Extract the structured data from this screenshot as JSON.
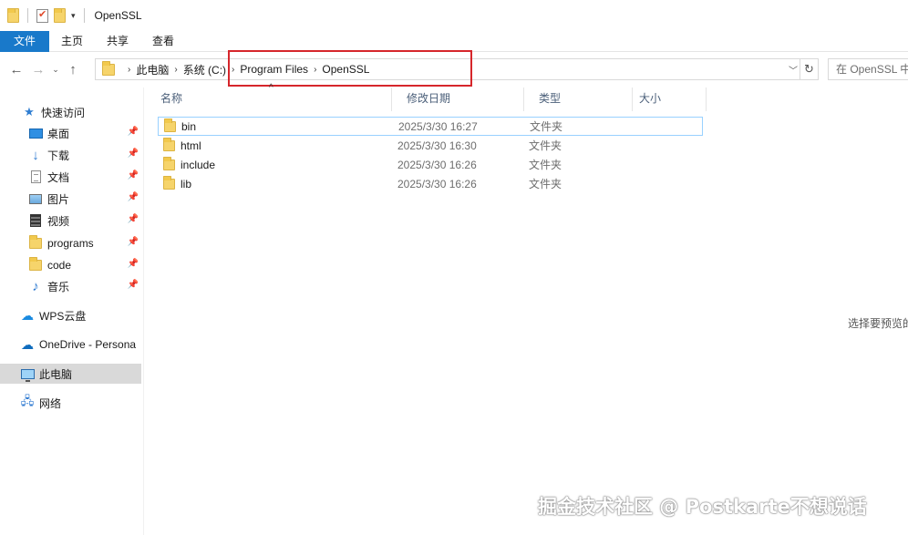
{
  "window": {
    "title": "OpenSSL"
  },
  "ribbon": {
    "tabs": [
      "文件",
      "主页",
      "共享",
      "查看"
    ]
  },
  "address": {
    "breadcrumbs": [
      "此电脑",
      "系统 (C:)",
      "Program Files",
      "OpenSSL"
    ],
    "search_placeholder": "在 OpenSSL 中"
  },
  "sidebar": {
    "quick_access": "快速访问",
    "items": [
      {
        "label": "桌面",
        "icon": "desktop-icon",
        "pinned": true
      },
      {
        "label": "下载",
        "icon": "download-icon",
        "pinned": true
      },
      {
        "label": "文档",
        "icon": "document-icon",
        "pinned": true
      },
      {
        "label": "图片",
        "icon": "picture-icon",
        "pinned": true
      },
      {
        "label": "视频",
        "icon": "video-icon",
        "pinned": true
      },
      {
        "label": "programs",
        "icon": "folder-icon",
        "pinned": true
      },
      {
        "label": "code",
        "icon": "folder-icon",
        "pinned": true
      },
      {
        "label": "音乐",
        "icon": "music-icon",
        "pinned": true
      }
    ],
    "wps": "WPS云盘",
    "onedrive": "OneDrive - Persona",
    "this_pc": "此电脑",
    "network": "网络"
  },
  "columns": {
    "name": "名称",
    "date": "修改日期",
    "type": "类型",
    "size": "大小"
  },
  "files": [
    {
      "name": "bin",
      "date": "2025/3/30 16:27",
      "type": "文件夹",
      "selected": true
    },
    {
      "name": "html",
      "date": "2025/3/30 16:30",
      "type": "文件夹",
      "selected": false
    },
    {
      "name": "include",
      "date": "2025/3/30 16:26",
      "type": "文件夹",
      "selected": false
    },
    {
      "name": "lib",
      "date": "2025/3/30 16:26",
      "type": "文件夹",
      "selected": false
    }
  ],
  "preview_hint": "选择要预览的",
  "watermark": "掘金技术社区 @ Postkarte不想说话",
  "colors": {
    "accent": "#1979ca",
    "highlight_box": "#d6262b",
    "selection_border": "#99d1ff",
    "selected_nav": "#d9d9d9"
  }
}
